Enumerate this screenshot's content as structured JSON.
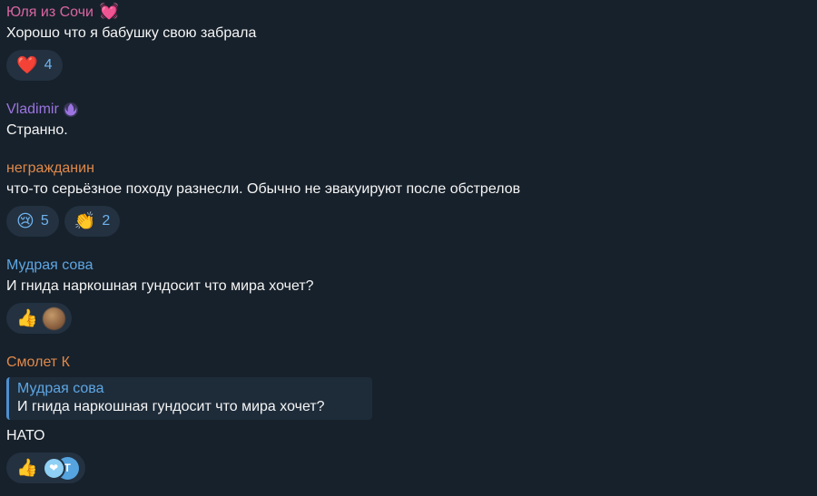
{
  "colors": {
    "background": "#17212b",
    "reaction_bg": "#233140",
    "reaction_count": "#6fb3ee"
  },
  "messages": [
    {
      "author": "Юля из Сочи",
      "author_color": "#d966a2",
      "author_emoji": "💓",
      "text": "Хорошо что я бабушку свою забрала",
      "reactions": [
        {
          "emoji": "❤️",
          "count": "4"
        }
      ]
    },
    {
      "author": "Vladimir",
      "author_color": "#9b74e0",
      "author_emoji": "rebel-alliance-icon",
      "text": "Странно."
    },
    {
      "author": "негражданин",
      "author_color": "#e0894a",
      "text": "что-то серьёзное походу разнесли. Обычно не эвакуируют после обстрелов",
      "reactions": [
        {
          "emoji": "😢",
          "count": "5"
        },
        {
          "emoji": "👏",
          "count": "2"
        }
      ]
    },
    {
      "author": "Мудрая сова",
      "author_color": "#5ea6e3",
      "text": "И гнида наркошная гундосит что мира хочет?",
      "reactions": [
        {
          "emoji": "👍",
          "avatar": "blurred-user-avatar"
        }
      ]
    },
    {
      "author": "Смолет К",
      "author_color": "#e0894a",
      "reply": {
        "author": "Мудрая сова",
        "text": "И гнида наркошная гундосит что мира хочет?"
      },
      "text": "НАТО",
      "reactions": [
        {
          "emoji": "👍",
          "avatars": [
            "❤",
            "T"
          ]
        }
      ]
    }
  ]
}
